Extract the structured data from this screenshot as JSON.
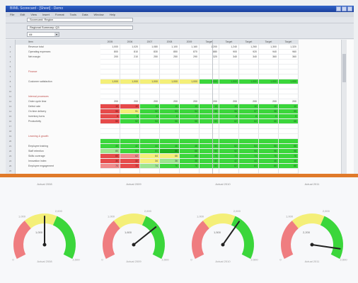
{
  "window": {
    "title": "BI/ML Scorecard - [Sheet] - Demo"
  },
  "menu": [
    "File",
    "Edit",
    "View",
    "Insert",
    "Format",
    "Tools",
    "Data",
    "Window",
    "Help"
  ],
  "toolbar": {
    "field1": "Scorecard: Region",
    "field2": "Regional Summary: Q3",
    "dropdown": "All"
  },
  "grid": {
    "headers": [
      "Item",
      "2005",
      "2006",
      "2007",
      "2008",
      "2009",
      "Target",
      "Target",
      "Target",
      "Target",
      "Target"
    ],
    "rows": [
      {
        "n": "1",
        "label": "Revenue total",
        "cells": [
          "1,000",
          "1,020",
          "1,080",
          "1,100",
          "1,160",
          "1,200",
          "1,240",
          "1,260",
          "1,300",
          "1,320"
        ],
        "colors": [
          "w",
          "w",
          "w",
          "w",
          "w",
          "w",
          "w",
          "w",
          "w",
          "w"
        ]
      },
      {
        "n": "2",
        "label": "Operating expenses",
        "cells": [
          "800",
          "810",
          "830",
          "850",
          "870",
          "880",
          "900",
          "920",
          "940",
          "960"
        ],
        "colors": [
          "w",
          "w",
          "w",
          "w",
          "w",
          "w",
          "w",
          "w",
          "w",
          "w"
        ]
      },
      {
        "n": "3",
        "label": "Net margin",
        "cells": [
          "200",
          "210",
          "250",
          "250",
          "290",
          "320",
          "340",
          "340",
          "360",
          "360"
        ],
        "colors": [
          "w",
          "w",
          "w",
          "w",
          "w",
          "w",
          "w",
          "w",
          "w",
          "w"
        ]
      },
      {
        "n": "4",
        "label": "",
        "cells": [
          "",
          "",
          "",
          "",
          "",
          "",
          "",
          "",
          "",
          ""
        ],
        "colors": [
          "w",
          "w",
          "w",
          "w",
          "w",
          "w",
          "w",
          "w",
          "w",
          "w"
        ]
      },
      {
        "n": "5",
        "label": "",
        "cells": [
          "",
          "",
          "",
          "",
          "",
          "",
          "",
          "",
          "",
          ""
        ],
        "colors": [
          "w",
          "w",
          "w",
          "w",
          "w",
          "w",
          "w",
          "w",
          "w",
          "w"
        ]
      },
      {
        "n": "6",
        "label": "Finance",
        "sec": true,
        "cells": [
          "",
          "",
          "",
          "",
          "",
          "",
          "",
          "",
          "",
          ""
        ],
        "colors": [
          "w",
          "w",
          "w",
          "w",
          "w",
          "w",
          "w",
          "w",
          "w",
          "w"
        ]
      },
      {
        "n": "7",
        "label": "",
        "cells": [
          "",
          "",
          "",
          "",
          "",
          "",
          "",
          "",
          "",
          ""
        ],
        "colors": [
          "w",
          "w",
          "w",
          "w",
          "w",
          "w",
          "w",
          "w",
          "w",
          "w"
        ]
      },
      {
        "n": "8",
        "label": "Customer satisfaction",
        "cells": [
          "1,000",
          "1,000",
          "1,000",
          "1,000",
          "1,000",
          "1,000",
          "1,000",
          "1,000",
          "1,000",
          "1,000"
        ],
        "colors": [
          "y",
          "y",
          "y",
          "y",
          "y",
          "g",
          "g",
          "g",
          "g",
          "g"
        ]
      },
      {
        "n": "9",
        "label": "",
        "cells": [
          "",
          "",
          "",
          "",
          "",
          "",
          "",
          "",
          "",
          ""
        ],
        "colors": [
          "w",
          "w",
          "w",
          "w",
          "w",
          "w",
          "w",
          "w",
          "w",
          "w"
        ]
      },
      {
        "n": "10",
        "label": "",
        "cells": [
          "",
          "",
          "",
          "",
          "",
          "",
          "",
          "",
          "",
          ""
        ],
        "colors": [
          "w",
          "w",
          "w",
          "w",
          "w",
          "w",
          "w",
          "w",
          "w",
          "w"
        ]
      },
      {
        "n": "11",
        "label": "Internal processes",
        "sec": true,
        "cells": [
          "",
          "",
          "",
          "",
          "",
          "",
          "",
          "",
          "",
          ""
        ],
        "colors": [
          "w",
          "w",
          "w",
          "w",
          "w",
          "w",
          "w",
          "w",
          "w",
          "w"
        ]
      },
      {
        "n": "12",
        "label": "Order cycle time",
        "cells": [
          "200",
          "200",
          "200",
          "200",
          "200",
          "200",
          "200",
          "200",
          "200",
          "200"
        ],
        "colors": [
          "w",
          "w",
          "w",
          "w",
          "w",
          "w",
          "w",
          "w",
          "w",
          "w"
        ]
      },
      {
        "n": "13",
        "label": "Defect rate",
        "cells": [
          "10",
          "10",
          "10",
          "10",
          "10",
          "10",
          "10",
          "10",
          "10",
          "10"
        ],
        "colors": [
          "r",
          "r",
          "g",
          "g",
          "g",
          "g",
          "g",
          "g",
          "g",
          "g"
        ]
      },
      {
        "n": "14",
        "label": "On time delivery",
        "cells": [
          "90",
          "91",
          "92",
          "93",
          "94",
          "95",
          "96",
          "97",
          "98",
          "99"
        ],
        "colors": [
          "r",
          "y",
          "g",
          "g",
          "g",
          "g",
          "g",
          "g",
          "g",
          "g"
        ]
      },
      {
        "n": "15",
        "label": "Inventory turns",
        "cells": [
          "5",
          "5",
          "6",
          "6",
          "7",
          "7",
          "8",
          "8",
          "9",
          "9"
        ],
        "colors": [
          "r",
          "g",
          "g",
          "g",
          "g",
          "g",
          "g",
          "g",
          "g",
          "g"
        ]
      },
      {
        "n": "16",
        "label": "Productivity",
        "cells": [
          "50",
          "52",
          "54",
          "56",
          "58",
          "60",
          "62",
          "64",
          "66",
          "68"
        ],
        "colors": [
          "r",
          "g",
          "g",
          "g",
          "g",
          "g",
          "g",
          "g",
          "g",
          "g"
        ]
      },
      {
        "n": "17",
        "label": "",
        "cells": [
          "",
          "",
          "",
          "",
          "",
          "",
          "",
          "",
          "",
          ""
        ],
        "colors": [
          "w",
          "w",
          "w",
          "w",
          "w",
          "w",
          "w",
          "w",
          "w",
          "w"
        ]
      },
      {
        "n": "18",
        "label": "",
        "cells": [
          "",
          "",
          "",
          "",
          "",
          "",
          "",
          "",
          "",
          ""
        ],
        "colors": [
          "w",
          "w",
          "w",
          "w",
          "w",
          "w",
          "w",
          "w",
          "w",
          "w"
        ]
      },
      {
        "n": "19",
        "label": "Learning & growth",
        "sec": true,
        "cells": [
          "",
          "",
          "",
          "",
          "",
          "",
          "",
          "",
          "",
          ""
        ],
        "colors": [
          "w",
          "w",
          "w",
          "w",
          "w",
          "w",
          "w",
          "w",
          "w",
          "w"
        ]
      },
      {
        "n": "20",
        "label": "",
        "cells": [
          "",
          "",
          "",
          "",
          "",
          "",
          "",
          "",
          "",
          ""
        ],
        "colors": [
          "g",
          "g",
          "g",
          "g",
          "g",
          "g",
          "g",
          "g",
          "g",
          "g"
        ]
      },
      {
        "n": "21",
        "label": "Employee training",
        "cells": [
          "40",
          "42",
          "44",
          "46",
          "48",
          "50",
          "52",
          "54",
          "56",
          "58"
        ],
        "colors": [
          "g",
          "g",
          "g",
          "g",
          "g",
          "g",
          "g",
          "g",
          "g",
          "g"
        ]
      },
      {
        "n": "22",
        "label": "Staff retention",
        "cells": [
          "80",
          "82",
          "84",
          "86",
          "88",
          "90",
          "92",
          "94",
          "96",
          "98"
        ],
        "colors": [
          "lg",
          "g",
          "g",
          "dg",
          "g",
          "g",
          "g",
          "g",
          "g",
          "g"
        ]
      },
      {
        "n": "23",
        "label": "Skills coverage",
        "cells": [
          "60",
          "62",
          "64",
          "66",
          "68",
          "70",
          "72",
          "74",
          "76",
          "78"
        ],
        "colors": [
          "r",
          "lr",
          "y",
          "y",
          "g",
          "g",
          "g",
          "g",
          "g",
          "g"
        ]
      },
      {
        "n": "24",
        "label": "Innovation index",
        "cells": [
          "30",
          "32",
          "34",
          "36",
          "38",
          "40",
          "42",
          "44",
          "46",
          "48"
        ],
        "colors": [
          "r",
          "r",
          "y",
          "lg",
          "g",
          "g",
          "g",
          "g",
          "g",
          "g"
        ]
      },
      {
        "n": "25",
        "label": "Employee engagement",
        "cells": [
          "70",
          "72",
          "74",
          "76",
          "78",
          "80",
          "82",
          "84",
          "86",
          "88"
        ],
        "colors": [
          "lr",
          "r",
          "lg",
          "g",
          "g",
          "g",
          "g",
          "g",
          "g",
          "g"
        ]
      },
      {
        "n": "26",
        "label": "",
        "cells": [
          "",
          "",
          "",
          "",
          "",
          "",
          "",
          "",
          "",
          ""
        ],
        "colors": [
          "w",
          "w",
          "w",
          "w",
          "w",
          "w",
          "w",
          "w",
          "w",
          "w"
        ]
      }
    ]
  },
  "gauges": [
    {
      "title": "Actual 2008",
      "min_label": "0",
      "low_label": "1,000",
      "high_label": "2,000",
      "max_label": "2,500",
      "value_label": "1,000",
      "value": 0.5,
      "footer": "Actual 2008"
    },
    {
      "title": "Actual 2009",
      "min_label": "0",
      "low_label": "1,000",
      "high_label": "2,000",
      "max_label": "2,500",
      "value_label": "1,600",
      "value": 0.72,
      "footer": "Actual 2009"
    },
    {
      "title": "Actual 2010",
      "min_label": "0",
      "low_label": "1,000",
      "high_label": "2,000",
      "max_label": "2,500",
      "value_label": "1,500",
      "value": 0.65,
      "footer": "Actual 2010"
    },
    {
      "title": "Actual 2011",
      "min_label": "0",
      "low_label": "1,000",
      "high_label": "2,000",
      "max_label": "2,500",
      "value_label": "2,200",
      "value": 0.92,
      "footer": "Actual 2011"
    }
  ],
  "colors": {
    "good": "#3bd63b",
    "warning": "#f4ef78",
    "bad": "#e64a4a",
    "divider": "#e07a2a",
    "title_bar": "#2f63c9"
  }
}
